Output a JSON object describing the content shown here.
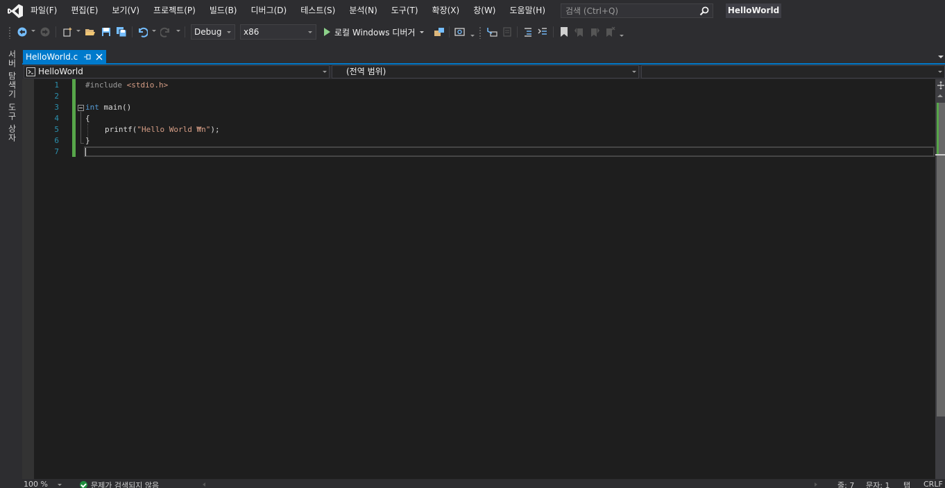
{
  "menu": {
    "items": [
      "파일(F)",
      "편집(E)",
      "보기(V)",
      "프로젝트(P)",
      "빌드(B)",
      "디버그(D)",
      "테스트(S)",
      "분석(N)",
      "도구(T)",
      "확장(X)",
      "창(W)",
      "도움말(H)"
    ],
    "search_placeholder": "검색 (Ctrl+Q)",
    "solution_name": "HelloWorld"
  },
  "toolbar": {
    "configuration": "Debug",
    "platform": "x86",
    "run_label": "로컬 Windows 디버거"
  },
  "side_tabs": [
    "서버 탐색기",
    "도구 상자"
  ],
  "tab": {
    "title": "HelloWorld.c"
  },
  "navbar": {
    "project": "HelloWorld",
    "scope": "(전역 범위)",
    "member": ""
  },
  "editor": {
    "line_numbers": [
      "1",
      "2",
      "3",
      "4",
      "5",
      "6",
      "7"
    ],
    "code": {
      "line1_directive": "#include",
      "line1_header": "<stdio.h>",
      "line3_keyword": "int",
      "line3_rest": " main()",
      "line4": "{",
      "line5_func": "printf(",
      "line5_string": "\"Hello World ₩n\"",
      "line5_end": ");",
      "line6": "}",
      "line7": ""
    }
  },
  "status": {
    "zoom": "100 %",
    "issues": "문제가 검색되지 않음",
    "line": "줄: 7",
    "char": "문자: 1",
    "indent": "탭",
    "eol": "CRLF"
  },
  "colors": {
    "accent": "#007acc",
    "keyword": "#569cd6",
    "string": "#d69d85",
    "line_number": "#2b91af",
    "change_marker": "#57a64a",
    "editor_bg": "#1e1e1e",
    "chrome_bg": "#2d2d30"
  },
  "icons": [
    "vs-logo-icon",
    "search-icon",
    "back-icon",
    "forward-icon",
    "new-project-icon",
    "open-folder-icon",
    "save-icon",
    "save-all-icon",
    "undo-icon",
    "redo-icon",
    "run-icon",
    "pin-icon",
    "close-icon",
    "check-icon"
  ]
}
